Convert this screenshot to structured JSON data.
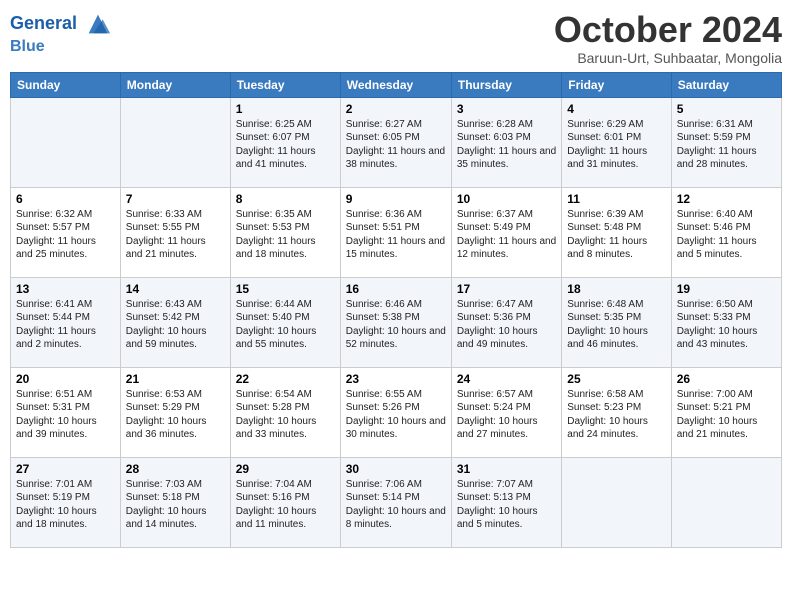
{
  "header": {
    "logo_line1": "General",
    "logo_line2": "Blue",
    "month": "October 2024",
    "location": "Baruun-Urt, Suhbaatar, Mongolia"
  },
  "days_of_week": [
    "Sunday",
    "Monday",
    "Tuesday",
    "Wednesday",
    "Thursday",
    "Friday",
    "Saturday"
  ],
  "weeks": [
    [
      {
        "day": "",
        "content": ""
      },
      {
        "day": "",
        "content": ""
      },
      {
        "day": "1",
        "content": "Sunrise: 6:25 AM\nSunset: 6:07 PM\nDaylight: 11 hours and 41 minutes."
      },
      {
        "day": "2",
        "content": "Sunrise: 6:27 AM\nSunset: 6:05 PM\nDaylight: 11 hours and 38 minutes."
      },
      {
        "day": "3",
        "content": "Sunrise: 6:28 AM\nSunset: 6:03 PM\nDaylight: 11 hours and 35 minutes."
      },
      {
        "day": "4",
        "content": "Sunrise: 6:29 AM\nSunset: 6:01 PM\nDaylight: 11 hours and 31 minutes."
      },
      {
        "day": "5",
        "content": "Sunrise: 6:31 AM\nSunset: 5:59 PM\nDaylight: 11 hours and 28 minutes."
      }
    ],
    [
      {
        "day": "6",
        "content": "Sunrise: 6:32 AM\nSunset: 5:57 PM\nDaylight: 11 hours and 25 minutes."
      },
      {
        "day": "7",
        "content": "Sunrise: 6:33 AM\nSunset: 5:55 PM\nDaylight: 11 hours and 21 minutes."
      },
      {
        "day": "8",
        "content": "Sunrise: 6:35 AM\nSunset: 5:53 PM\nDaylight: 11 hours and 18 minutes."
      },
      {
        "day": "9",
        "content": "Sunrise: 6:36 AM\nSunset: 5:51 PM\nDaylight: 11 hours and 15 minutes."
      },
      {
        "day": "10",
        "content": "Sunrise: 6:37 AM\nSunset: 5:49 PM\nDaylight: 11 hours and 12 minutes."
      },
      {
        "day": "11",
        "content": "Sunrise: 6:39 AM\nSunset: 5:48 PM\nDaylight: 11 hours and 8 minutes."
      },
      {
        "day": "12",
        "content": "Sunrise: 6:40 AM\nSunset: 5:46 PM\nDaylight: 11 hours and 5 minutes."
      }
    ],
    [
      {
        "day": "13",
        "content": "Sunrise: 6:41 AM\nSunset: 5:44 PM\nDaylight: 11 hours and 2 minutes."
      },
      {
        "day": "14",
        "content": "Sunrise: 6:43 AM\nSunset: 5:42 PM\nDaylight: 10 hours and 59 minutes."
      },
      {
        "day": "15",
        "content": "Sunrise: 6:44 AM\nSunset: 5:40 PM\nDaylight: 10 hours and 55 minutes."
      },
      {
        "day": "16",
        "content": "Sunrise: 6:46 AM\nSunset: 5:38 PM\nDaylight: 10 hours and 52 minutes."
      },
      {
        "day": "17",
        "content": "Sunrise: 6:47 AM\nSunset: 5:36 PM\nDaylight: 10 hours and 49 minutes."
      },
      {
        "day": "18",
        "content": "Sunrise: 6:48 AM\nSunset: 5:35 PM\nDaylight: 10 hours and 46 minutes."
      },
      {
        "day": "19",
        "content": "Sunrise: 6:50 AM\nSunset: 5:33 PM\nDaylight: 10 hours and 43 minutes."
      }
    ],
    [
      {
        "day": "20",
        "content": "Sunrise: 6:51 AM\nSunset: 5:31 PM\nDaylight: 10 hours and 39 minutes."
      },
      {
        "day": "21",
        "content": "Sunrise: 6:53 AM\nSunset: 5:29 PM\nDaylight: 10 hours and 36 minutes."
      },
      {
        "day": "22",
        "content": "Sunrise: 6:54 AM\nSunset: 5:28 PM\nDaylight: 10 hours and 33 minutes."
      },
      {
        "day": "23",
        "content": "Sunrise: 6:55 AM\nSunset: 5:26 PM\nDaylight: 10 hours and 30 minutes."
      },
      {
        "day": "24",
        "content": "Sunrise: 6:57 AM\nSunset: 5:24 PM\nDaylight: 10 hours and 27 minutes."
      },
      {
        "day": "25",
        "content": "Sunrise: 6:58 AM\nSunset: 5:23 PM\nDaylight: 10 hours and 24 minutes."
      },
      {
        "day": "26",
        "content": "Sunrise: 7:00 AM\nSunset: 5:21 PM\nDaylight: 10 hours and 21 minutes."
      }
    ],
    [
      {
        "day": "27",
        "content": "Sunrise: 7:01 AM\nSunset: 5:19 PM\nDaylight: 10 hours and 18 minutes."
      },
      {
        "day": "28",
        "content": "Sunrise: 7:03 AM\nSunset: 5:18 PM\nDaylight: 10 hours and 14 minutes."
      },
      {
        "day": "29",
        "content": "Sunrise: 7:04 AM\nSunset: 5:16 PM\nDaylight: 10 hours and 11 minutes."
      },
      {
        "day": "30",
        "content": "Sunrise: 7:06 AM\nSunset: 5:14 PM\nDaylight: 10 hours and 8 minutes."
      },
      {
        "day": "31",
        "content": "Sunrise: 7:07 AM\nSunset: 5:13 PM\nDaylight: 10 hours and 5 minutes."
      },
      {
        "day": "",
        "content": ""
      },
      {
        "day": "",
        "content": ""
      }
    ]
  ]
}
